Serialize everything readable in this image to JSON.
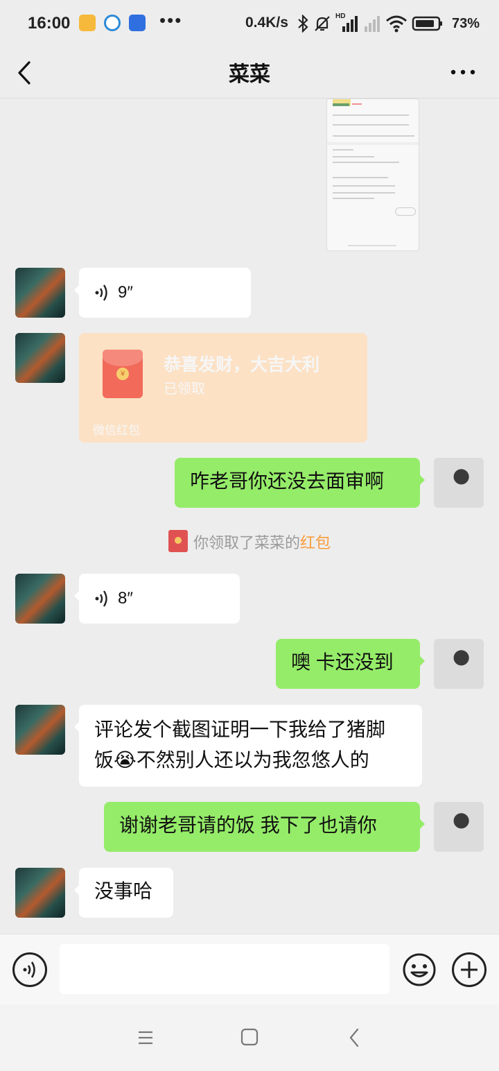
{
  "status_bar": {
    "time": "16:00",
    "overflow_dots": "•••",
    "network_speed": "0.4K/s",
    "hd_label": "HD",
    "battery_text": "73%"
  },
  "header": {
    "title": "菜菜",
    "back_icon": "chevron-left-icon",
    "more_icon": "more-dots-icon"
  },
  "messages": {
    "voice1": {
      "duration": "9″"
    },
    "red_packet": {
      "title": "恭喜发财，大吉大利",
      "status": "已领取",
      "footer": "微信红包"
    },
    "me1": {
      "text": "咋老哥你还没去面审啊"
    },
    "system": {
      "prefix": "你领取了菜菜的",
      "highlight": "红包"
    },
    "voice2": {
      "duration": "8″"
    },
    "me2": {
      "text": "噢 卡还没到"
    },
    "other3": {
      "line1": "评论发个截图证明一下我给了猪脚",
      "line2_a": "饭",
      "line2_emoji": "😭",
      "line2_b": "不然别人还以为我忽悠人的"
    },
    "me3": {
      "text": "谢谢老哥请的饭 我下了也请你"
    },
    "other4": {
      "text": "没事哈"
    }
  },
  "input_bar": {
    "voice_icon": "voice-mode-icon",
    "emoji_icon": "emoji-icon",
    "plus_icon": "plus-icon"
  },
  "colors": {
    "background": "#ededed",
    "my_bubble": "#95ec69",
    "other_bubble": "#ffffff",
    "red_packet_received": "#fce1c5",
    "link_orange": "#fa9d3b"
  }
}
